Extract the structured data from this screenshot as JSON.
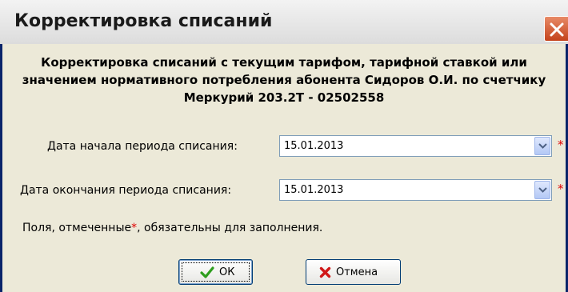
{
  "window": {
    "title": "Корректировка списаний"
  },
  "dialog": {
    "heading": "Корректировка списаний с текущим тарифом, тарифной ставкой или значением нормативного потребления абонента Сидоров О.И. по счетчику Меркурий 203.2Т - 02502558",
    "fields": {
      "start_label": "Дата начала периода списания:",
      "start_value": "15.01.2013",
      "end_label": "Дата окончания периода списания:",
      "end_value": "15.01.2013",
      "required_mark": "*"
    },
    "note_prefix": "Поля, отмеченные",
    "note_star": "*",
    "note_suffix": ", обязательны для заполнения.",
    "buttons": {
      "ok_label": "ОК",
      "cancel_label": "Отмена"
    }
  },
  "colors": {
    "required": "#e00000",
    "frame": "#0a246a",
    "ok_icon": "#2e9e1e",
    "cancel_icon": "#d01818"
  }
}
